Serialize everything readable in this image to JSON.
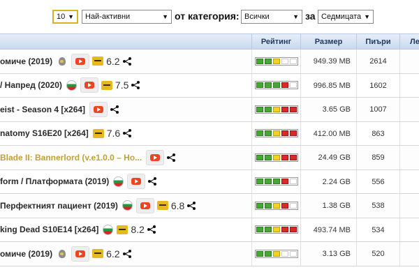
{
  "filter": {
    "count": "10",
    "sort": "Най-активни",
    "from_category_label": "от категория:",
    "category": "Всички",
    "for_label": "за",
    "period": "Седмицата"
  },
  "columns": {
    "rating": "Рейтинг",
    "size": "Размер",
    "seeders": "Пиъри",
    "leechers": "Ле"
  },
  "rows": [
    {
      "title": "омиче (2019)",
      "gold": false,
      "icons": [
        "anim",
        "yt",
        "imdb"
      ],
      "score": "6.2",
      "rating": [
        "g",
        "g",
        "y",
        "w",
        "w"
      ],
      "size": "949.39 MB",
      "seeders": "2614"
    },
    {
      "title": "/ Напред (2020)",
      "gold": false,
      "icons": [
        "flag",
        "yt",
        "imdb"
      ],
      "score": "7.5",
      "rating": [
        "g",
        "g",
        "g",
        "r",
        "w"
      ],
      "size": "996.85 MB",
      "seeders": "1602"
    },
    {
      "title": "eist - Season 4 [x264]",
      "gold": false,
      "icons": [
        "yt"
      ],
      "score": "",
      "rating": [
        "g",
        "g",
        "y",
        "r",
        "r"
      ],
      "size": "3.65 GB",
      "seeders": "1007"
    },
    {
      "title": "natomy S16E20 [x264]",
      "gold": false,
      "icons": [
        "imdb"
      ],
      "score": "7.6",
      "rating": [
        "g",
        "g",
        "y",
        "r",
        "r"
      ],
      "size": "412.00 MB",
      "seeders": "863"
    },
    {
      "title": "Blade II: Bannerlord (v.e1.0.0 – Ho...",
      "gold": true,
      "icons": [
        "yt"
      ],
      "score": "",
      "rating": [
        "g",
        "g",
        "y",
        "r",
        "r"
      ],
      "size": "24.49 GB",
      "seeders": "859"
    },
    {
      "title": "form / Платформата (2019)",
      "gold": false,
      "icons": [
        "flag",
        "yt"
      ],
      "score": "",
      "rating": [
        "g",
        "g",
        "g",
        "r",
        "w"
      ],
      "size": "2.24 GB",
      "seeders": "556"
    },
    {
      "title": "Перфектният пациент (2019)",
      "gold": false,
      "icons": [
        "flag",
        "yt",
        "imdb"
      ],
      "score": "6.8",
      "rating": [
        "g",
        "g",
        "y",
        "r",
        "w"
      ],
      "size": "1.38 GB",
      "seeders": "538"
    },
    {
      "title": "king Dead S10E14 [x264]",
      "gold": false,
      "icons": [
        "flag",
        "imdb"
      ],
      "score": "8.2",
      "rating": [
        "g",
        "g",
        "y",
        "r",
        "r"
      ],
      "size": "493.74 MB",
      "seeders": "534"
    },
    {
      "title": "омиче (2019)",
      "gold": false,
      "icons": [
        "anim",
        "yt",
        "imdb"
      ],
      "score": "6.2",
      "rating": [
        "g",
        "g",
        "y",
        "w",
        "w"
      ],
      "size": "3.13 GB",
      "seeders": "520"
    }
  ]
}
